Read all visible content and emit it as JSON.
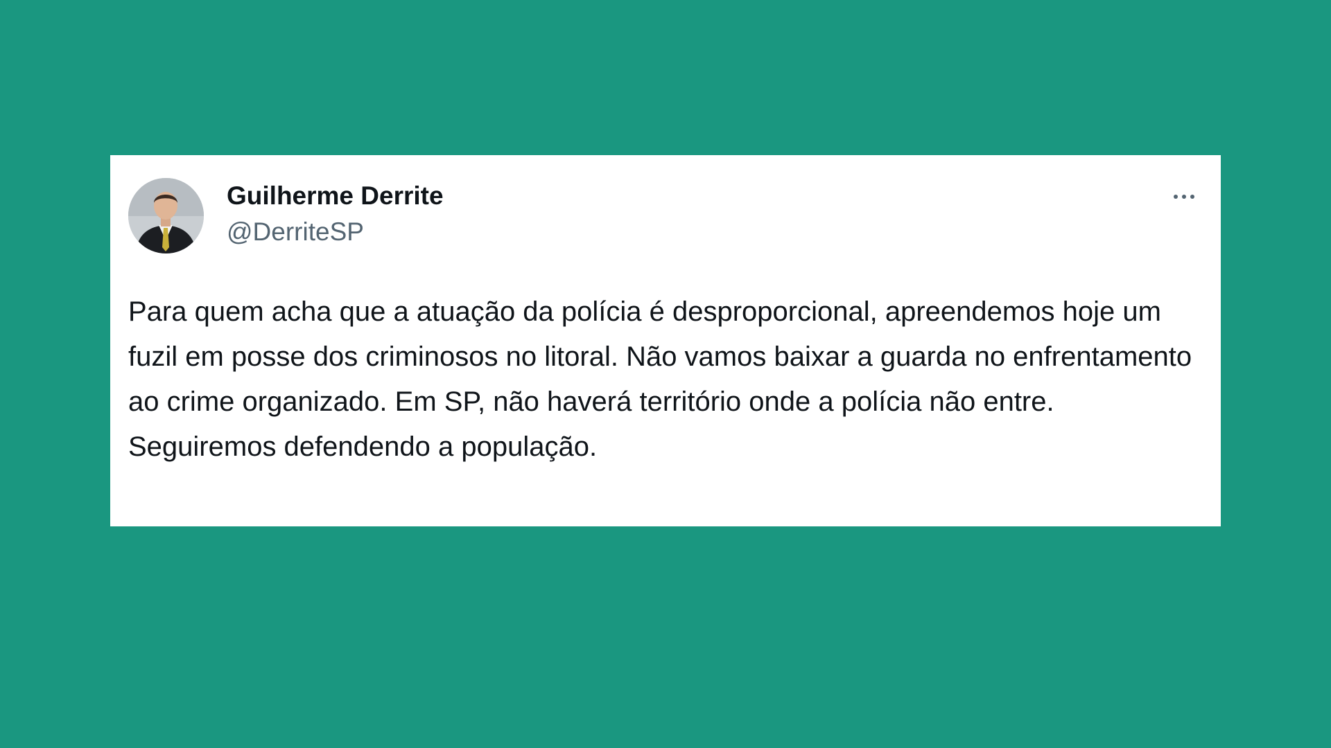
{
  "tweet": {
    "author_name": "Guilherme Derrite",
    "author_handle": "@DerriteSP",
    "avatar_icon": "profile-photo",
    "more_icon": "more-horizontal-icon",
    "text": "Para quem acha que a atuação da polícia é desproporcional, apreendemos hoje um fuzil em posse dos criminosos no litoral. Não vamos baixar a guarda no enfrentamento ao crime organizado. Em SP, não haverá território onde a polícia não entre. Seguiremos defendendo a população."
  },
  "colors": {
    "background": "#1a9780",
    "card": "#ffffff",
    "name_text": "#0f1419",
    "handle_text": "#536471"
  }
}
